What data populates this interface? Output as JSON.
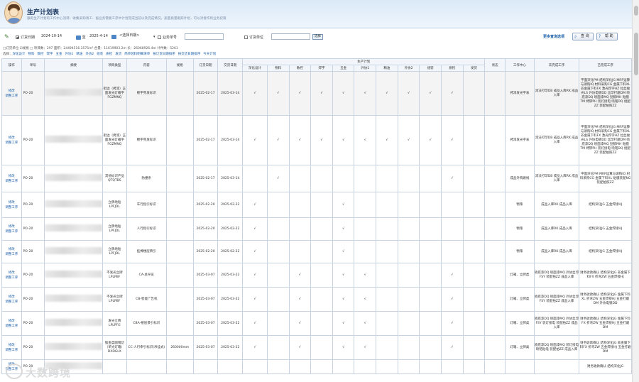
{
  "header": {
    "title": "生产计划表",
    "subtitle": "跟踪生产计划的工作中心流转、收集采购清工、报业务需要工序中计划完成当前以及完成情况，质量质量跟踪计划，可以对接作利业务权限"
  },
  "filter": {
    "order_date_label": "订货日期",
    "date_from": "2024-10-14",
    "date_sep": "至",
    "date_to": "2025-4-14",
    "range_select": "<选择日期>",
    "order_no_label": "业务单号",
    "order_unit_label": "订货单位",
    "go_label": "选择",
    "more_link": "更多查询选项",
    "search_button": "查 询",
    "help_button": "帮 助"
  },
  "info": {
    "line1": "□订货单位  ☑规格  □ 项目数：297 面积：24494516.3575m² 合量：11619903.2m 长：26068926.4m 计件数：5261",
    "line2_prefix": "选择：",
    "links": [
      "深化设计",
      "物料",
      "数控",
      "焊字",
      "五金",
      "外协1",
      "精油",
      "外协2",
      "组装",
      "质检",
      "发货",
      "简单领料明细清单",
      "按订货日期排序",
      "按交货日期排序",
      "今天计划"
    ]
  },
  "table": {
    "headers": {
      "op": "操作",
      "order_no": "单号",
      "summary": "摘要",
      "project_type": "项目类型",
      "content": "内容",
      "spec": "规格",
      "order_date": "订货日期",
      "delivery_date": "交货日期",
      "plan_group": "生产计划",
      "steps": [
        "深化设计",
        "物料",
        "数控",
        "焊字",
        "五金",
        "外协1",
        "精油",
        "外协2",
        "组装",
        "质检",
        "发货"
      ],
      "status": "状态",
      "work_center": "工作中心",
      "pending_process": "未完成工序",
      "done_process": "已完成工序"
    },
    "op_label": "修改\n调整工序",
    "rows": [
      {
        "no": "PO-20",
        "ptype": "街边（拷漆）正面发光灯箱字FGZMNQ",
        "content": "楼字完发标识",
        "spec": "",
        "od": "2025-02-17",
        "dd": "2025-03-14",
        "steps": [
          "√",
          "√",
          "√",
          "√",
          "√",
          "√",
          "√",
          "√",
          "√",
          "√",
          ""
        ],
        "status": "",
        "wc": "拷漆发光字表",
        "pending": "漆法打印DB 成品入库RK 成品入库",
        "done": "平面深化PM 结构深化JG MRP运算与请购IQ 材料采购CG 金属下料XL 非金属下料FX 激光焊字HZ 拉丝抛光LS 外协电镀DD 丝印打磨DM 喷底漆DQ 喷面漆MQ 刮腻MH 贴膜TM 烤锣PH 装灯接电 喷铭DQ 组配ZZ 装配拍照ZZ"
      },
      {
        "no": "PO-20",
        "ptype": "街边（拷漆）正面发光灯箱字FGZMNQ",
        "content": "楼字完发标识",
        "spec": "",
        "od": "2025-02-17",
        "dd": "2025-03-14",
        "steps": [
          "√",
          "√",
          "√",
          "√",
          "√",
          "√",
          "√",
          "√",
          "√",
          "√",
          ""
        ],
        "status": "",
        "wc": "拷漆发光字表",
        "pending": "漆法打印DB 成品入库RK 成品入库",
        "done": "平面深化PM 结构深化JG MRP运算与请购IQ 材料采购CG 金属下料XL 非金属下料FX 激光焊字HZ 拉丝抛光LS 外协电镀DD 丝印打磨DM 喷底漆DQ 喷面漆MQ 刮腻MH 贴膜TM 烤锣PH 装灯接电 喷铭DQ 组配ZZ 装配拍照ZZ"
      },
      {
        "no": "PO-20",
        "ptype": "其他标识产品QTQTBS",
        "content": "防撞条",
        "spec": "",
        "od": "2025-02-17",
        "dd": "2025-03-14",
        "steps": [
          "",
          "√",
          "",
          "",
          "",
          "",
          "",
          "",
          "",
          "√",
          ""
        ],
        "status": "",
        "wc": "成品外购路线",
        "pending": "漆法打印DB 成品入库RK 成品入库",
        "done": "平面深化PM MRP运算与请购IQ 材料采购CG 金属下料XL 贴膜装配NG 装配拍照ZZ"
      },
      {
        "no": "PO-20",
        "ptype": "立牌地贴LPFJDL",
        "content": "车行指引标识",
        "spec": "",
        "od": "2025-02-20",
        "dd": "2025-02-22",
        "steps": [
          "√",
          "",
          "",
          "",
          "√",
          "",
          "",
          "",
          "",
          "",
          ""
        ],
        "status": "",
        "wc": "物策",
        "pending": "成品入库RK 成品入库",
        "done": "结构深化JG 五金焊接HJ"
      },
      {
        "no": "PO-20",
        "ptype": "立牌地贴LPFJDL",
        "content": "人行指引标识",
        "spec": "",
        "od": "2025-02-20",
        "dd": "2025-02-22",
        "steps": [
          "√",
          "",
          "",
          "",
          "√",
          "",
          "",
          "",
          "",
          "",
          ""
        ],
        "status": "",
        "wc": "物策",
        "pending": "成品入库RK 成品入库",
        "done": "结构深化JG 五金焊接HJ"
      },
      {
        "no": "PO-20",
        "ptype": "立牌地贴LPFJDL",
        "content": "挂棒楼层牌引",
        "spec": "",
        "od": "2025-02-20",
        "dd": "2025-02-22",
        "steps": [
          "√",
          "",
          "",
          "",
          "√",
          "",
          "",
          "",
          "",
          "",
          ""
        ],
        "status": "",
        "wc": "物策",
        "pending": "成品入库RK 成品入库",
        "done": "结构深化JG 五金焊接HJ"
      },
      {
        "no": "PO-20",
        "ptype": "不发光立牌LPLPBF",
        "content": "CA-总导览",
        "spec": "",
        "od": "2025-03-07",
        "dd": "2025-03-22",
        "steps": [
          "√",
          "",
          "√",
          "",
          "√",
          "√",
          "",
          "",
          "",
          "√",
          ""
        ],
        "status": "",
        "wc": "灯箱、立牌类",
        "pending": "喷底漆DQ 喷面漆MQ 外协丝印FSY 装配拍ZZ 成品入库",
        "done": "财务收款确认 结构深化JG 非金属下料FX 折弯ZW 五金焊接HJ"
      },
      {
        "no": "PO-20",
        "ptype": "不发光立牌LPLPBF",
        "content": "CB-智能广告机",
        "spec": "",
        "od": "2025-03-07",
        "dd": "2025-03-22",
        "steps": [
          "√",
          "",
          "√",
          "",
          "√",
          "√",
          "",
          "",
          "",
          "√",
          ""
        ],
        "status": "",
        "wc": "灯箱、立牌类",
        "pending": "喷底漆DQ 喷面漆MQ 外协丝印FSY 装配拍ZZ 成品入库",
        "done": "财务收款确认 结构深化JG 金属下料XL 折弯ZW 五金焊接HJ 五金打磨DM 外协电镀DD"
      },
      {
        "no": "PO-20",
        "ptype": "发光立牌LPLPFG",
        "content": "CBA-楼层景引标识",
        "spec": "",
        "od": "2025-03-07",
        "dd": "2025-03-22",
        "steps": [
          "√",
          "",
          "√",
          "",
          "√",
          "√",
          "",
          "",
          "",
          "√",
          ""
        ],
        "status": "",
        "wc": "灯箱、立牌类",
        "pending": "喷底漆DQ 喷面漆MQ 外协丝印FSY 装灯接电 装配拍ZZ 成品入库",
        "done": "财务收款确认 结构深化JG 金属下料FX 折弯ZW 五金焊接HJ 五金打磨DM"
      },
      {
        "no": "PO-20",
        "ptype": "钣金类圆镜切（单光灯箱）DXDGLX",
        "content": "CC-人行牵引标识(吊挂式)",
        "spec": "260000mm",
        "od": "2025-03-07",
        "dd": "2025-03-22",
        "steps": [
          "√",
          "",
          "√",
          "",
          "√",
          "√",
          "",
          "",
          "",
          "√",
          ""
        ],
        "status": "",
        "wc": "灯箱、立牌类",
        "pending": "喷底漆DQ 喷面漆MQ 装灯接电 喷铭贴电 装配拍ZZ 成品入库",
        "done": "财务收款确认 结构深化JG 非金属下料FX 折弯ZW 五金焊接HJ 五金打磨DM"
      },
      {
        "no": "PO-20",
        "ptype": "",
        "content": "",
        "spec": "",
        "od": "",
        "dd": "",
        "steps": [
          "",
          "",
          "",
          "",
          "",
          "",
          "",
          "",
          "",
          "",
          ""
        ],
        "status": "",
        "wc": "",
        "pending": "",
        "done": "财务收款确认 结构深化JG"
      }
    ]
  },
  "watermark": {
    "text": "大数跨境"
  },
  "colors": {
    "header_bg": "#dbe9f7",
    "link": "#1b5ea8",
    "grid_border": "#c8d4e2"
  }
}
